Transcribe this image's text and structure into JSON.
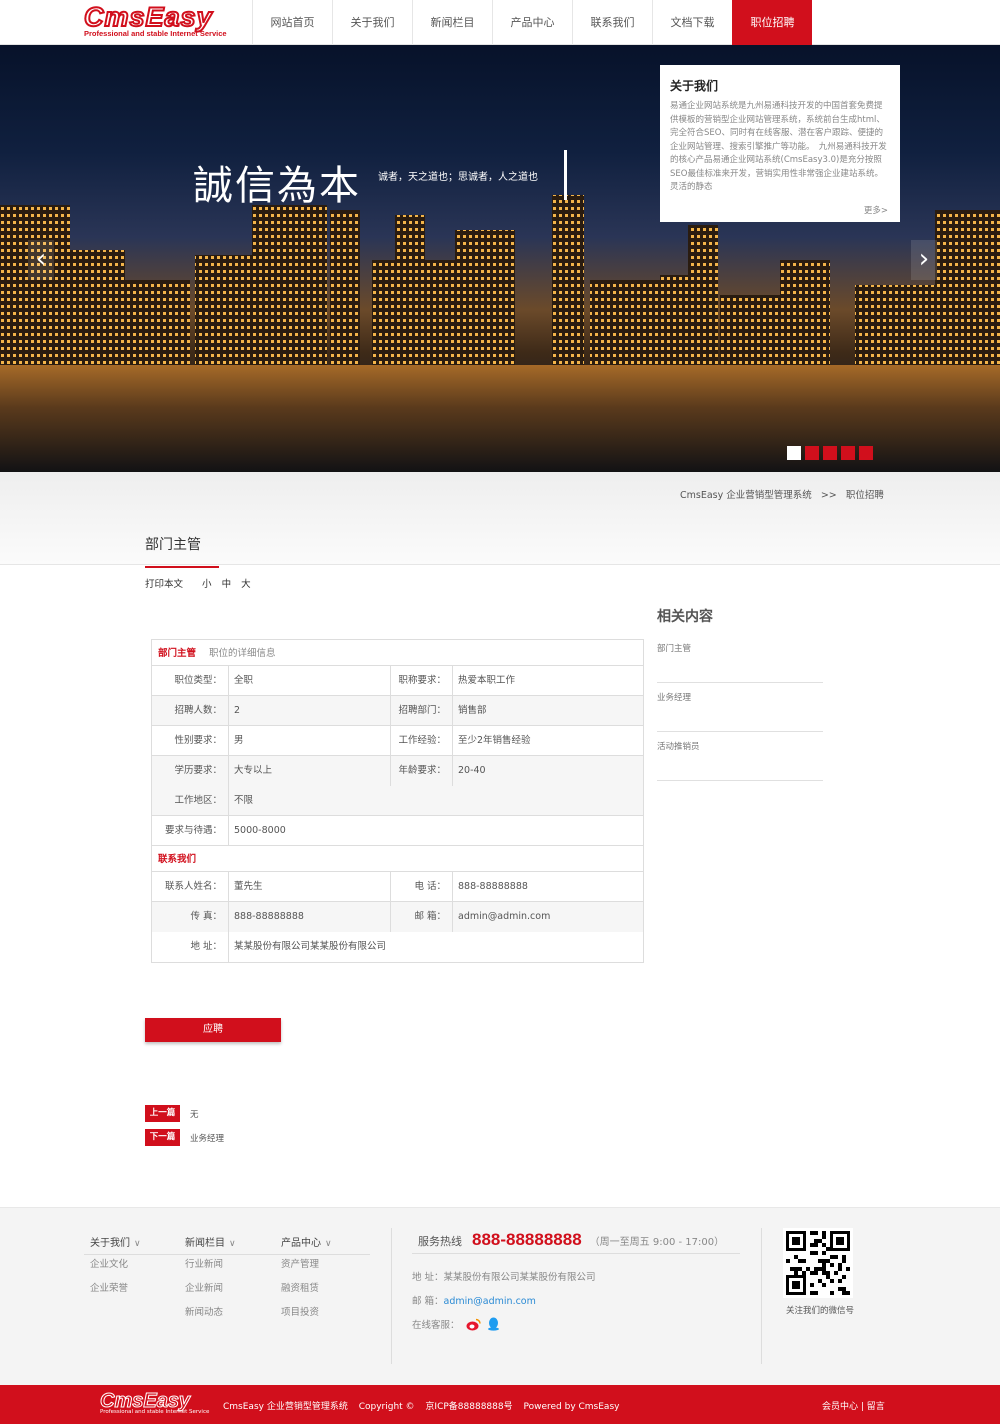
{
  "header": {
    "logo_text": "CmsEasy",
    "logo_sub": "Professional and stable Internet Service",
    "nav": [
      "网站首页",
      "关于我们",
      "新闻栏目",
      "产品中心",
      "联系我们",
      "文档下载",
      "职位招聘"
    ],
    "active_index": 6
  },
  "banner": {
    "headline": "誠信為本",
    "slogan": "诚者，天之道也；思诚者，人之道也",
    "prev_icon": "‹",
    "next_icon": "›",
    "slides": 5,
    "active_slide": 1,
    "about": {
      "title": "关于我们",
      "body": "易通企业网站系统是九州易通科技开发的中国首套免费提供模板的营销型企业网站管理系统，系统前台生成html、完全符合SEO、同时有在线客服、潜在客户跟踪、便捷的企业网站管理、搜索引擎推广等功能。　九州易通科技开发的核心产品易通企业网站系统(CmsEasy3.0)是充分按照SEO最佳标准来开发，营销实用性非常强企业建站系统。灵活的静态",
      "more": "更多>"
    }
  },
  "breadcrumb": {
    "site": "CmsEasy 企业营销型管理系统",
    "sep": ">>",
    "current": "职位招聘"
  },
  "page": {
    "title": "部门主管",
    "print": "打印本文",
    "font_small": "小",
    "font_mid": "中",
    "font_large": "大"
  },
  "job": {
    "header_red": "部门主管",
    "header_grey": "职位的详细信息",
    "rows": [
      {
        "l1": "职位类型：",
        "v1": "全职",
        "l2": "职称要求：",
        "v2": "热爱本职工作"
      },
      {
        "l1": "招聘人数：",
        "v1": "2",
        "l2": "招聘部门：",
        "v2": "销售部"
      },
      {
        "l1": "性别要求：",
        "v1": "男",
        "l2": "工作经验：",
        "v2": "至少2年销售经验"
      },
      {
        "l1": "学历要求：",
        "v1": "大专以上",
        "l2": "年龄要求：",
        "v2": "20-40"
      }
    ],
    "area_label": "工作地区：",
    "area_value": "不限",
    "pay_label": "要求与待遇：",
    "pay_value": "5000-8000",
    "contact_title": "联系我们",
    "contact_rows": [
      {
        "l1": "联系人姓名：",
        "v1": "董先生",
        "l2": "电 话：",
        "v2": "888-88888888"
      },
      {
        "l1": "传 真：",
        "v1": "888-88888888",
        "l2": "邮 箱：",
        "v2": "admin@admin.com"
      }
    ],
    "addr_label": "地 址：",
    "addr_value": "某某股份有限公司某某股份有限公司"
  },
  "apply_label": "应聘",
  "prevnext": {
    "prev_tag": "上一篇",
    "prev_text": "无",
    "next_tag": "下一篇",
    "next_text": "业务经理"
  },
  "related": {
    "title": "相关内容",
    "items": [
      "部门主管",
      "业务经理",
      "活动推销员"
    ]
  },
  "footer": {
    "cols": [
      {
        "title": "关于我们",
        "links": [
          "企业文化",
          "企业荣誉"
        ]
      },
      {
        "title": "新闻栏目",
        "links": [
          "行业新闻",
          "企业新闻",
          "新闻动态"
        ]
      },
      {
        "title": "产品中心",
        "links": [
          "资产管理",
          "融资租赁",
          "项目投资"
        ]
      }
    ],
    "chevron": "∨",
    "hotline_label": "服务热线",
    "hotline_number": "888-88888888",
    "hotline_time": "（周一至周五 9:00 - 17:00）",
    "address": "地 址：某某股份有限公司某某股份有限公司",
    "email_label": "邮 箱：",
    "email": "admin@admin.com",
    "service_label": "在线客服：",
    "qr_caption": "关注我们的微信号"
  },
  "bottom": {
    "site": "CmsEasy 企业营销型管理系统",
    "copyright": "Copyright ©",
    "icp": "京ICP备88888888号",
    "powered": "Powered by CmsEasy",
    "links": "会员中心 | 留言"
  },
  "colors": {
    "accent": "#d10f1c",
    "link": "#2a8ad4"
  }
}
